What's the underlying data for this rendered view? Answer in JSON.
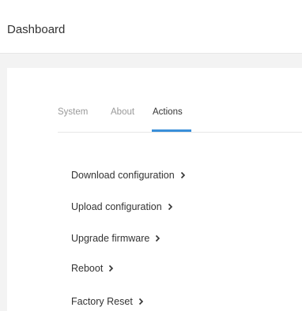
{
  "header": {
    "title": "Dashboard"
  },
  "tabs": [
    {
      "label": "System",
      "active": false
    },
    {
      "label": "About",
      "active": false
    },
    {
      "label": "Actions",
      "active": true
    }
  ],
  "actions": [
    {
      "label": "Download configuration",
      "icon": "chevron-right-icon"
    },
    {
      "label": "Upload configuration",
      "icon": "chevron-right-icon"
    },
    {
      "label": "Upgrade firmware",
      "icon": "chevron-right-icon"
    },
    {
      "label": "Reboot",
      "icon": "chevron-right-icon"
    },
    {
      "label": "Factory Reset",
      "icon": "chevron-right-icon"
    }
  ],
  "colors": {
    "accent": "#3a8fd9",
    "background": "#f3f3f3",
    "text": "#333333",
    "muted_text": "#999999"
  }
}
